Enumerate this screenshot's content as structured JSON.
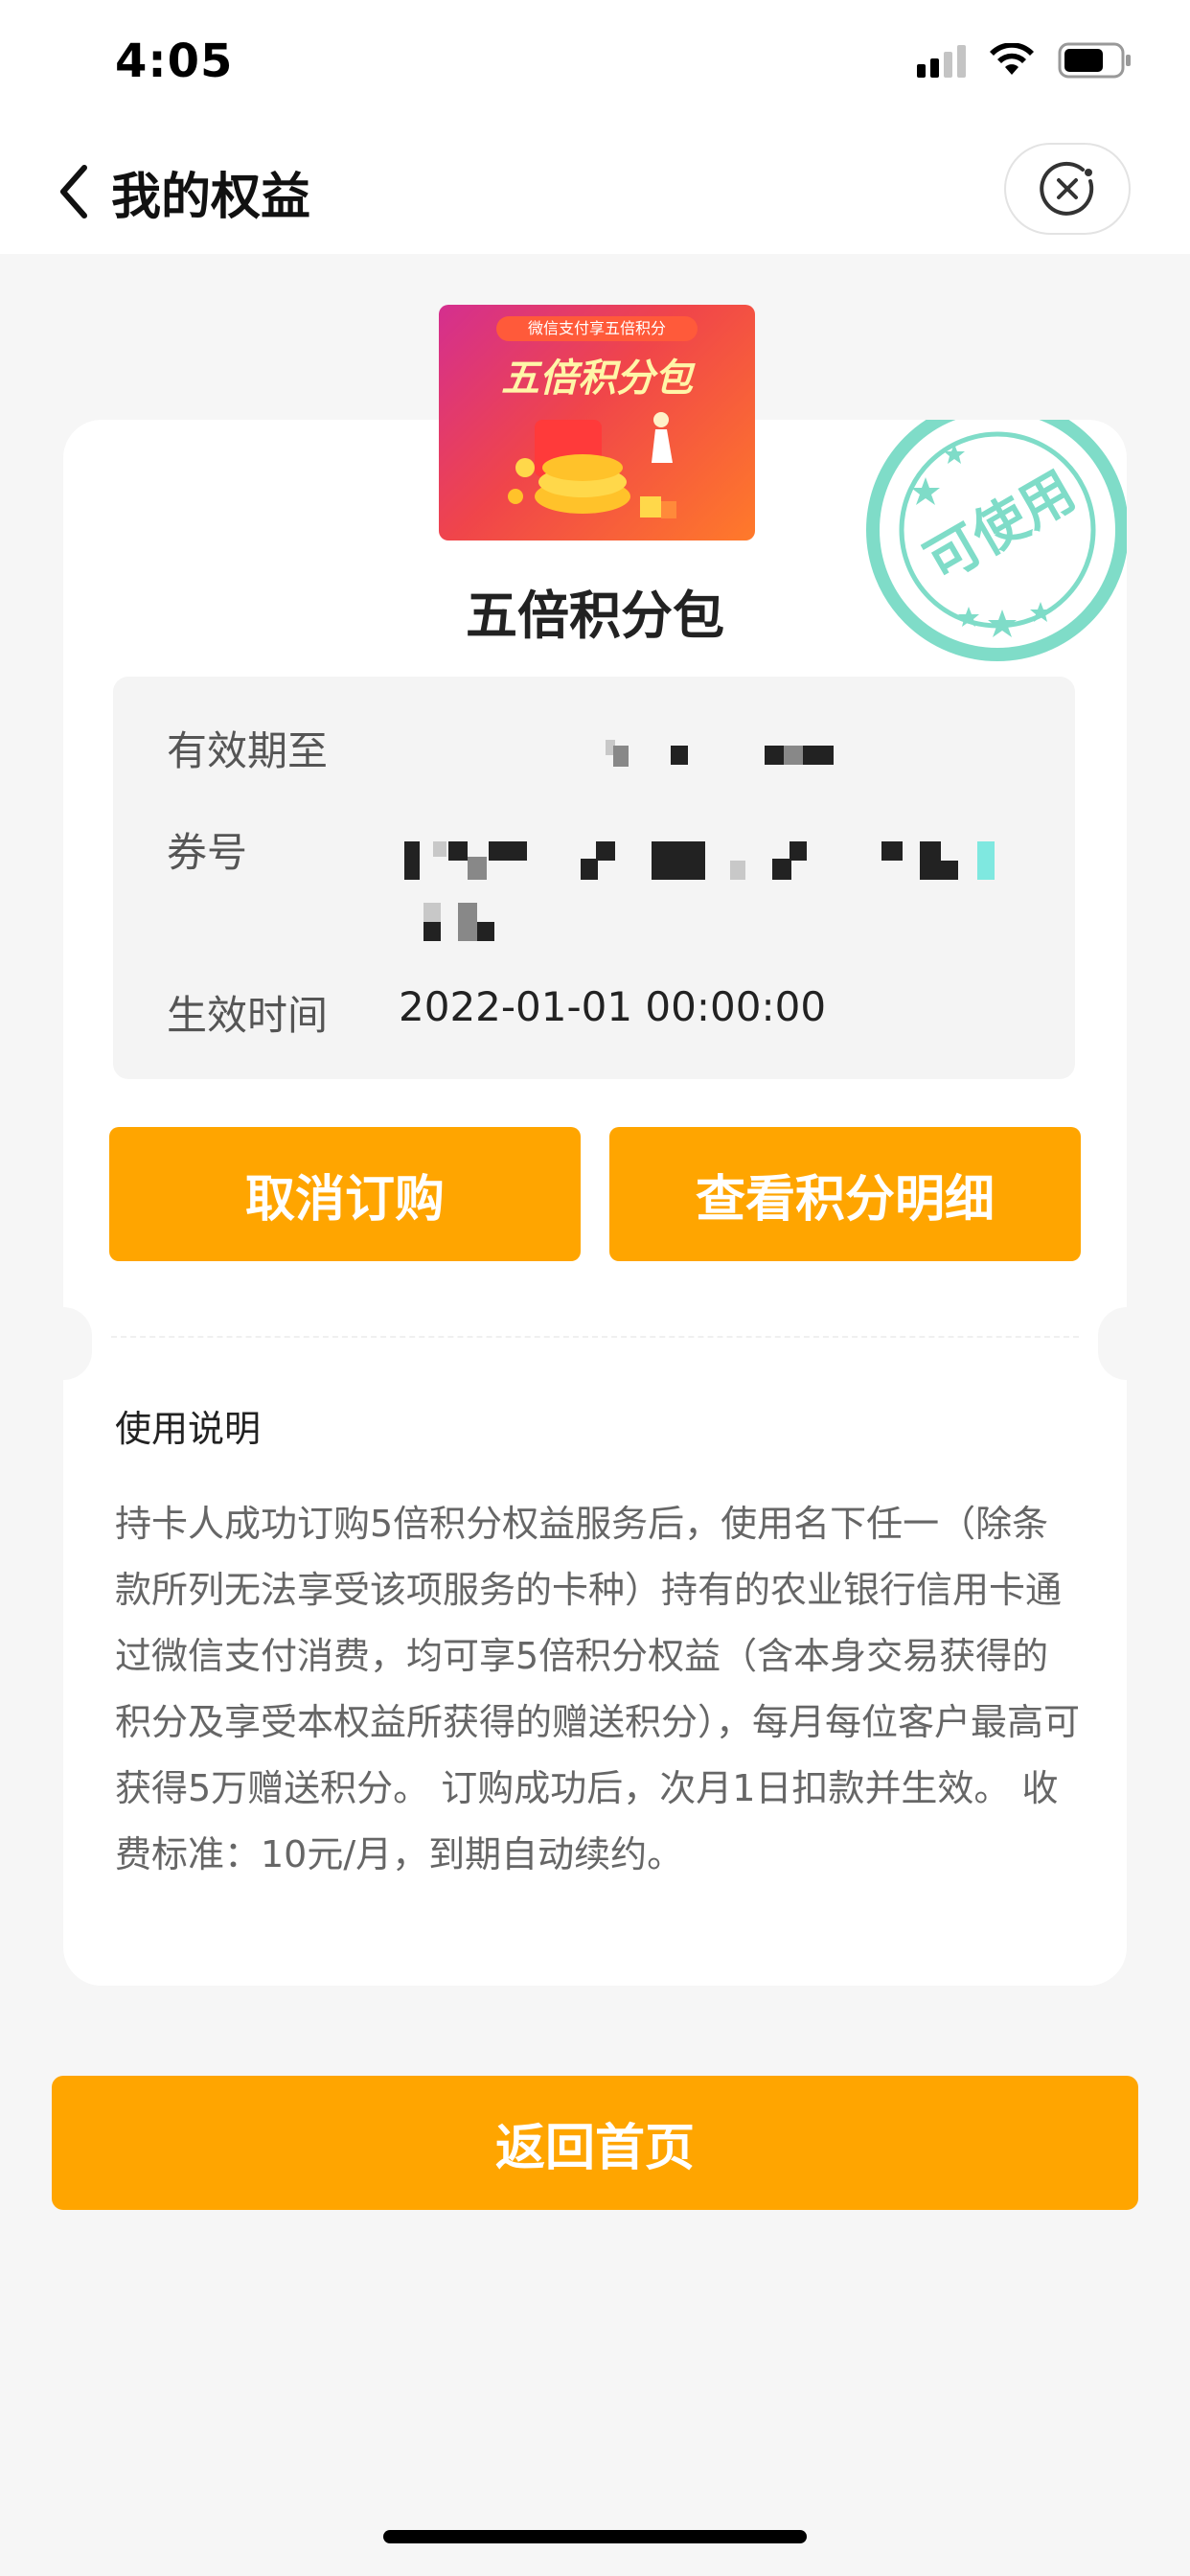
{
  "status_bar": {
    "time": "4:05"
  },
  "nav": {
    "title": "我的权益"
  },
  "product": {
    "image_banner_text": "微信支付享五倍积分",
    "image_big_text": "五倍积分包",
    "title": "五倍积分包",
    "stamp_text": "可使用"
  },
  "details": {
    "validity_label": "有效期至",
    "coupon_label": "券号",
    "effective_label": "生效时间",
    "effective_value": "2022-01-01 00:00:00"
  },
  "buttons": {
    "cancel": "取消订购",
    "view_points": "查看积分明细",
    "home": "返回首页"
  },
  "usage": {
    "title": "使用说明",
    "text": "持卡人成功订购5倍积分权益服务后，使用名下任一（除条款所列无法享受该项服务的卡种）持有的农业银行信用卡通过微信支付消费，均可享5倍积分权益（含本身交易获得的积分及享受本权益所获得的赠送积分），每月每位客户最高可获得5万赠送积分。 订购成功后，次月1日扣款并生效。 收费标准：10元/月，到期自动续约。"
  },
  "colors": {
    "accent": "#ffa500",
    "stamp": "#7fdcc8"
  }
}
